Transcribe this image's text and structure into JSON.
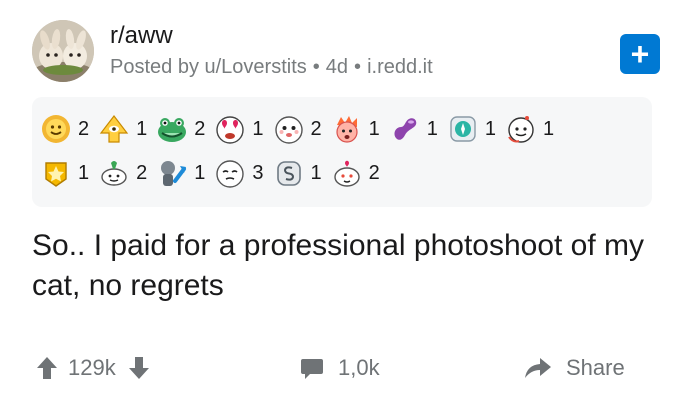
{
  "post": {
    "subreddit": "r/aww",
    "posted_by": "Posted by u/Loverstits",
    "age": "4d",
    "domain": "i.redd.it",
    "title": "So.. I paid for a professional photoshoot of my cat, no regrets"
  },
  "join_button": {
    "icon": "plus-icon",
    "label": "+"
  },
  "awards": {
    "row1": [
      {
        "icon": "sun-face-award",
        "count": "2"
      },
      {
        "icon": "all-seeing-upvote-award",
        "count": "1"
      },
      {
        "icon": "frog-face-award",
        "count": "2"
      },
      {
        "icon": "heart-eyes-award",
        "count": "1"
      },
      {
        "icon": "wholesome-face-award",
        "count": "2"
      },
      {
        "icon": "mind-blown-award",
        "count": "1"
      },
      {
        "icon": "jelly-bean-award",
        "count": "1"
      },
      {
        "icon": "glass-ball-award",
        "count": "1"
      },
      {
        "icon": "snoo-face-award",
        "count": "1"
      }
    ],
    "row2": [
      {
        "icon": "gold-star-award",
        "count": "1"
      },
      {
        "icon": "rocket-snoo-award",
        "count": "2"
      },
      {
        "icon": "robot-upvote-award",
        "count": "1"
      },
      {
        "icon": "sleepy-face-award",
        "count": "3"
      },
      {
        "icon": "silver-coin-award",
        "count": "1"
      },
      {
        "icon": "snoo-heart-award",
        "count": "2"
      }
    ]
  },
  "actions": {
    "upvotes": "129k",
    "comments": "1,0k",
    "share": "Share"
  },
  "colors": {
    "accent": "#0079d3",
    "meta": "#787c7e",
    "awards_bg": "#f6f7f8"
  }
}
